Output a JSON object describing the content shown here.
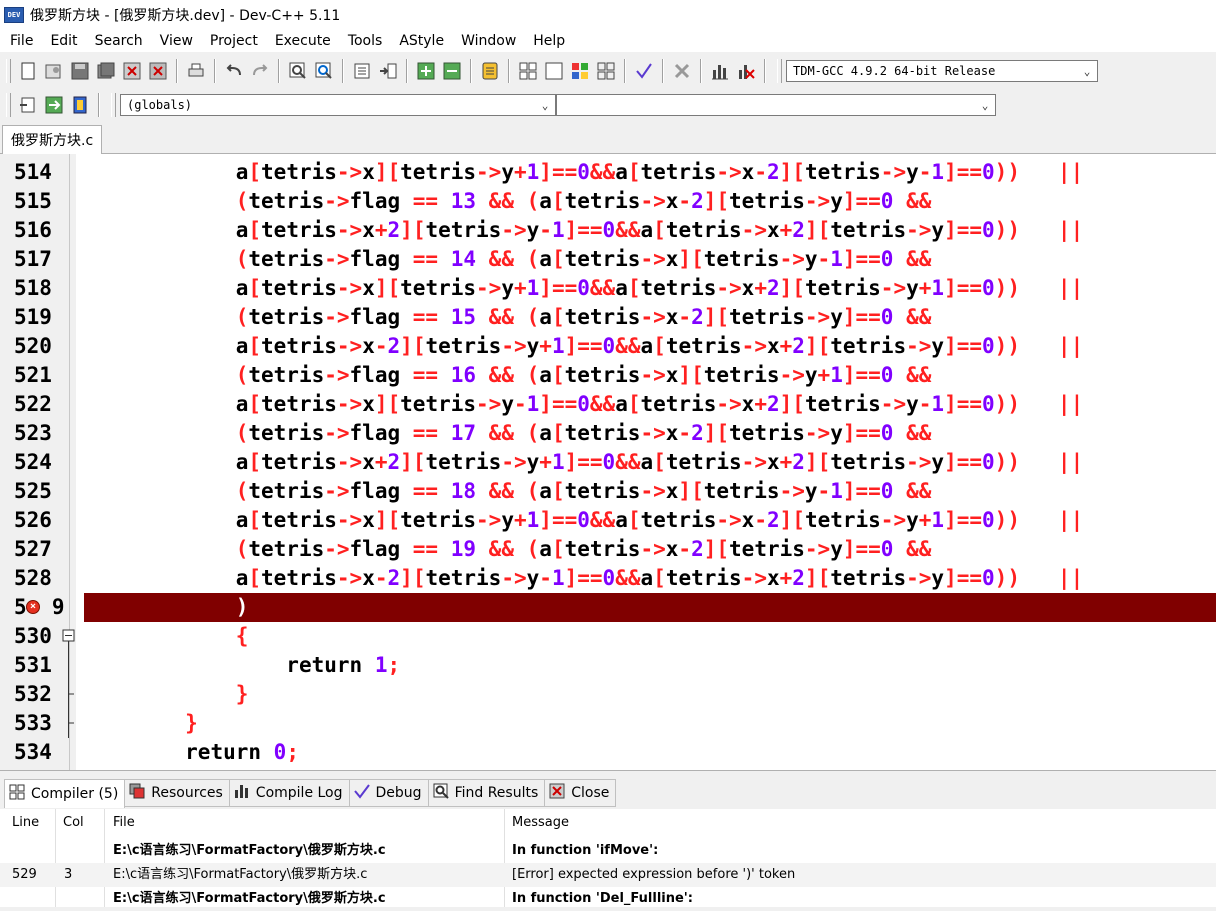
{
  "window": {
    "title": "俄罗斯方块 - [俄罗斯方块.dev] - Dev-C++ 5.11",
    "app_icon_text": "DEV"
  },
  "menu": [
    "File",
    "Edit",
    "Search",
    "View",
    "Project",
    "Execute",
    "Tools",
    "AStyle",
    "Window",
    "Help"
  ],
  "toolbar": {
    "compiler_select": "TDM-GCC 4.9.2 64-bit Release",
    "scope_select": "(globals)",
    "member_select": ""
  },
  "editor": {
    "active_tab": "俄罗斯方块.c",
    "error_line_number": "529",
    "lines": [
      {
        "num": "514",
        "code": "            a[tetris->x][tetris->y+1]==0&&a[tetris->x-2][tetris->y-1]==0))   ||"
      },
      {
        "num": "515",
        "code": "            (tetris->flag == 13 && (a[tetris->x-2][tetris->y]==0 &&"
      },
      {
        "num": "516",
        "code": "            a[tetris->x+2][tetris->y-1]==0&&a[tetris->x+2][tetris->y]==0))   ||"
      },
      {
        "num": "517",
        "code": "            (tetris->flag == 14 && (a[tetris->x][tetris->y-1]==0 &&"
      },
      {
        "num": "518",
        "code": "            a[tetris->x][tetris->y+1]==0&&a[tetris->x+2][tetris->y+1]==0))   ||"
      },
      {
        "num": "519",
        "code": "            (tetris->flag == 15 && (a[tetris->x-2][tetris->y]==0 &&"
      },
      {
        "num": "520",
        "code": "            a[tetris->x-2][tetris->y+1]==0&&a[tetris->x+2][tetris->y]==0))   ||"
      },
      {
        "num": "521",
        "code": "            (tetris->flag == 16 && (a[tetris->x][tetris->y+1]==0 &&"
      },
      {
        "num": "522",
        "code": "            a[tetris->x][tetris->y-1]==0&&a[tetris->x+2][tetris->y-1]==0))   ||"
      },
      {
        "num": "523",
        "code": "            (tetris->flag == 17 && (a[tetris->x-2][tetris->y]==0 &&"
      },
      {
        "num": "524",
        "code": "            a[tetris->x+2][tetris->y+1]==0&&a[tetris->x+2][tetris->y]==0))   ||"
      },
      {
        "num": "525",
        "code": "            (tetris->flag == 18 && (a[tetris->x][tetris->y-1]==0 &&"
      },
      {
        "num": "526",
        "code": "            a[tetris->x][tetris->y+1]==0&&a[tetris->x-2][tetris->y+1]==0))   ||"
      },
      {
        "num": "527",
        "code": "            (tetris->flag == 19 && (a[tetris->x-2][tetris->y]==0 &&"
      },
      {
        "num": "528",
        "code": "            a[tetris->x-2][tetris->y-1]==0&&a[tetris->x+2][tetris->y]==0))   ||"
      },
      {
        "num": "5  9",
        "code": "            )"
      },
      {
        "num": "530",
        "code": "            {"
      },
      {
        "num": "531",
        "code": "                return 1;"
      },
      {
        "num": "532",
        "code": "            }"
      },
      {
        "num": "533",
        "code": "        }"
      },
      {
        "num": "534",
        "code": "        return 0;"
      }
    ]
  },
  "bottom_tabs": [
    {
      "label": "Compiler (5)",
      "icon": "grid-icon"
    },
    {
      "label": "Resources",
      "icon": "resources-icon"
    },
    {
      "label": "Compile Log",
      "icon": "bar-chart-icon"
    },
    {
      "label": "Debug",
      "icon": "check-icon"
    },
    {
      "label": "Find Results",
      "icon": "find-icon"
    },
    {
      "label": "Close",
      "icon": "close-icon"
    }
  ],
  "compiler_table": {
    "headers": [
      "Line",
      "Col",
      "File",
      "Message"
    ],
    "rows": [
      {
        "line": "",
        "col": "",
        "file": "E:\\c语言练习\\FormatFactory\\俄罗斯方块.c",
        "message": "In function 'ifMove':"
      },
      {
        "line": "529",
        "col": "3",
        "file": "E:\\c语言练习\\FormatFactory\\俄罗斯方块.c",
        "message": "[Error] expected expression before ')' token"
      },
      {
        "line": "",
        "col": "",
        "file": "E:\\c语言练习\\FormatFactory\\俄罗斯方块.c",
        "message": "In function 'Del_Fullline':"
      }
    ]
  },
  "colors": {
    "error_line_bg": "#800000",
    "symbol": "#ff2020",
    "number": "#8000ff",
    "identifier": "#000000"
  }
}
